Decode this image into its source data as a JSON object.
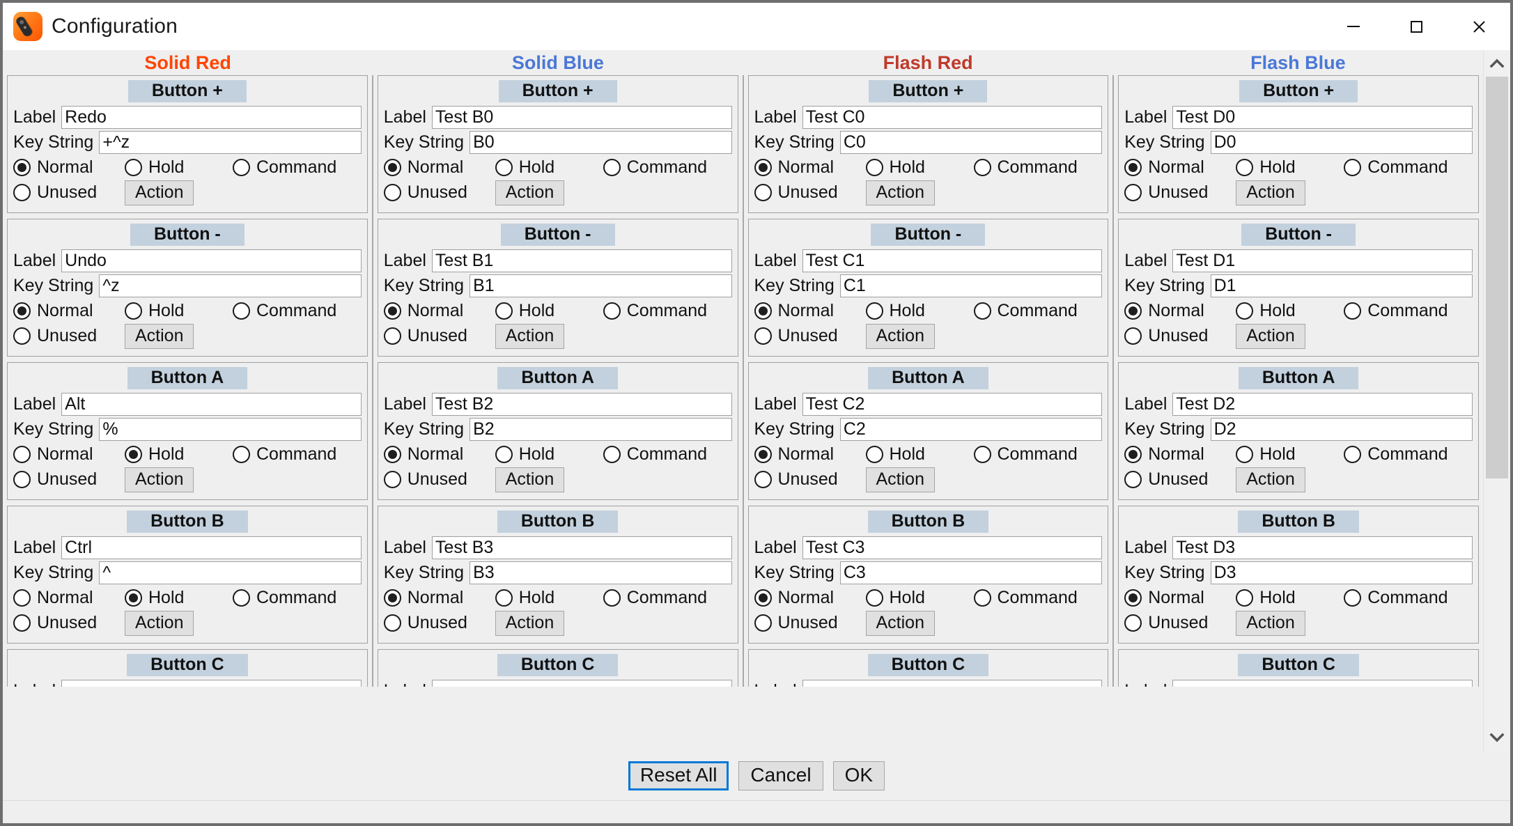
{
  "window": {
    "title": "Configuration",
    "icon": "presenter-remote-icon",
    "controls": {
      "minimize": "minimize-icon",
      "maximize": "maximize-icon",
      "close": "close-icon"
    }
  },
  "columns": [
    {
      "header": "Solid Red",
      "color": "#FF4500"
    },
    {
      "header": "Solid Blue",
      "color": "#4A78D6"
    },
    {
      "header": "Flash Red",
      "color": "#C0392B"
    },
    {
      "header": "Flash Blue",
      "color": "#4A78D6"
    }
  ],
  "field_labels": {
    "label": "Label",
    "key_string": "Key String"
  },
  "modes": [
    "Normal",
    "Hold",
    "Command",
    "Unused"
  ],
  "action_label": "Action",
  "groups": [
    {
      "column": "Solid Red",
      "items": [
        {
          "title": "Button +",
          "label": "Redo",
          "key_string": "+^z",
          "mode": "Normal",
          "partial": false
        },
        {
          "title": "Button -",
          "label": "Undo",
          "key_string": "^z",
          "mode": "Normal",
          "partial": false
        },
        {
          "title": "Button A",
          "label": "Alt",
          "key_string": "%",
          "mode": "Hold",
          "partial": false
        },
        {
          "title": "Button B",
          "label": "Ctrl",
          "key_string": "^",
          "mode": "Hold",
          "partial": false
        },
        {
          "title": "Button C",
          "label": "",
          "key_string": "",
          "mode": "Normal",
          "partial": true
        }
      ]
    },
    {
      "column": "Solid Blue",
      "items": [
        {
          "title": "Button +",
          "label": "Test B0",
          "key_string": "B0",
          "mode": "Normal",
          "partial": false
        },
        {
          "title": "Button -",
          "label": "Test B1",
          "key_string": "B1",
          "mode": "Normal",
          "partial": false
        },
        {
          "title": "Button A",
          "label": "Test B2",
          "key_string": "B2",
          "mode": "Normal",
          "partial": false
        },
        {
          "title": "Button B",
          "label": "Test B3",
          "key_string": "B3",
          "mode": "Normal",
          "partial": false
        },
        {
          "title": "Button C",
          "label": "",
          "key_string": "",
          "mode": "Normal",
          "partial": true
        }
      ]
    },
    {
      "column": "Flash Red",
      "items": [
        {
          "title": "Button +",
          "label": "Test C0",
          "key_string": "C0",
          "mode": "Normal",
          "partial": false
        },
        {
          "title": "Button -",
          "label": "Test C1",
          "key_string": "C1",
          "mode": "Normal",
          "partial": false
        },
        {
          "title": "Button A",
          "label": "Test C2",
          "key_string": "C2",
          "mode": "Normal",
          "partial": false
        },
        {
          "title": "Button B",
          "label": "Test C3",
          "key_string": "C3",
          "mode": "Normal",
          "partial": false
        },
        {
          "title": "Button C",
          "label": "",
          "key_string": "",
          "mode": "Normal",
          "partial": true
        }
      ]
    },
    {
      "column": "Flash Blue",
      "items": [
        {
          "title": "Button +",
          "label": "Test D0",
          "key_string": "D0",
          "mode": "Normal",
          "partial": false
        },
        {
          "title": "Button -",
          "label": "Test D1",
          "key_string": "D1",
          "mode": "Normal",
          "partial": false
        },
        {
          "title": "Button A",
          "label": "Test D2",
          "key_string": "D2",
          "mode": "Normal",
          "partial": false
        },
        {
          "title": "Button B",
          "label": "Test D3",
          "key_string": "D3",
          "mode": "Normal",
          "partial": false
        },
        {
          "title": "Button C",
          "label": "",
          "key_string": "",
          "mode": "Normal",
          "partial": true
        }
      ]
    }
  ],
  "scrollbar": {
    "up_arrow": "chevron-up-icon",
    "down_arrow": "chevron-down-icon",
    "thumb_position_pct": 0
  },
  "footer": {
    "reset_all": "Reset All",
    "cancel": "Cancel",
    "ok": "OK",
    "focused_button": "Reset All"
  }
}
